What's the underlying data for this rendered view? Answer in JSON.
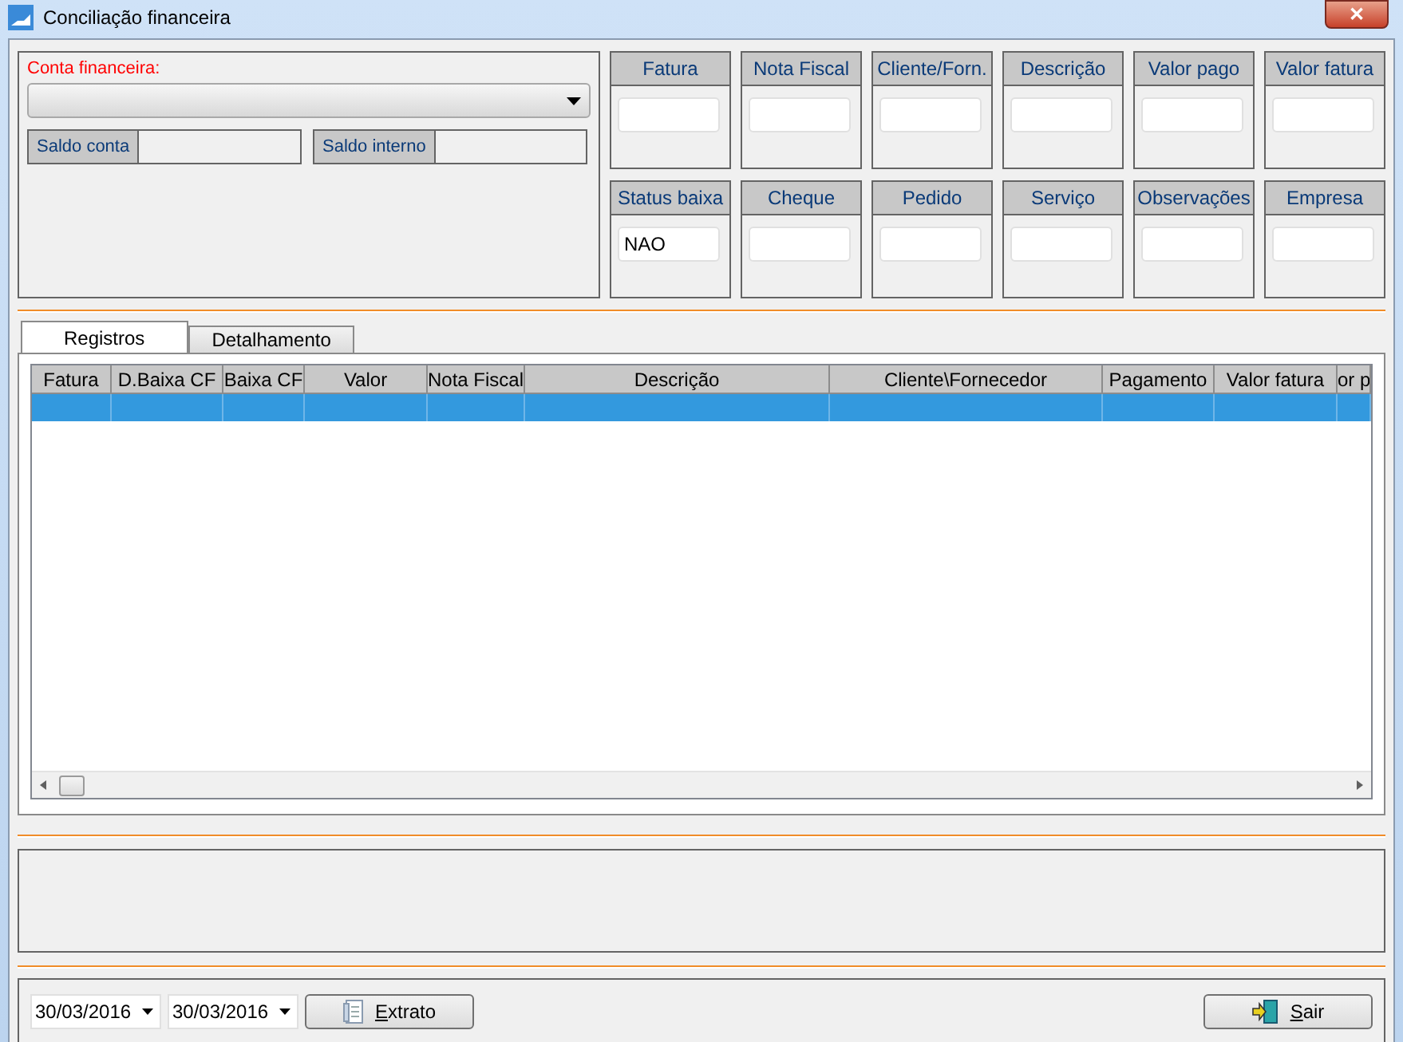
{
  "window": {
    "title": "Conciliação financeira",
    "close_glyph": "✕"
  },
  "account": {
    "label": "Conta financeira:",
    "value_label_1": "Saldo conta",
    "value_label_2": "Saldo interno"
  },
  "filters": [
    {
      "label": "Fatura"
    },
    {
      "label": "Nota Fiscal"
    },
    {
      "label": "Cliente/Forn."
    },
    {
      "label": "Descrição"
    },
    {
      "label": "Valor pago"
    },
    {
      "label": "Valor fatura"
    },
    {
      "label": "Status baixa",
      "value": "NAO"
    },
    {
      "label": "Cheque"
    },
    {
      "label": "Pedido"
    },
    {
      "label": "Serviço"
    },
    {
      "label": "Observações"
    },
    {
      "label": "Empresa"
    }
  ],
  "tabs": [
    {
      "label": "Registros",
      "selected": true
    },
    {
      "label": "Detalhamento",
      "selected": false
    }
  ],
  "table": {
    "columns": [
      "Fatura",
      "D.Baixa CF",
      "Baixa CF",
      "Valor",
      "Nota Fiscal",
      "Descrição",
      "Cliente\\Fornecedor",
      "Pagamento",
      "Valor fatura",
      "or p"
    ],
    "rows": [
      {
        "selected": true
      }
    ]
  },
  "footer": {
    "date_from": "30/03/2016",
    "date_to": "30/03/2016",
    "buttons": [
      {
        "kind": "extract",
        "label": "Extrato",
        "mnemonic_first": true
      },
      {
        "kind": "exit",
        "label": "Sair",
        "mnemonic_first": true
      }
    ]
  }
}
